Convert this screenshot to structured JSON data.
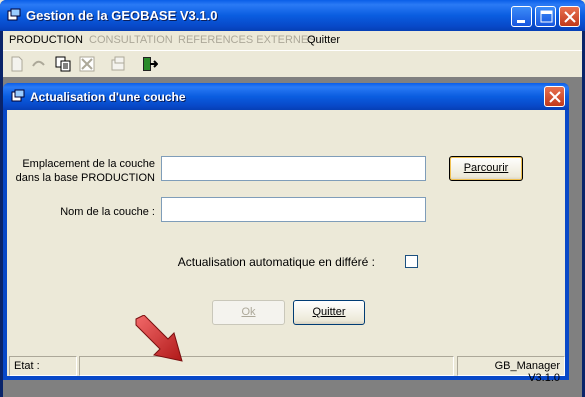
{
  "app": {
    "title": "Gestion de la GEOBASE V3.1.0"
  },
  "menu": {
    "items": [
      {
        "label": "PRODUCTION",
        "enabled": true
      },
      {
        "label": "CONSULTATION",
        "enabled": false
      },
      {
        "label": "REFERENCES EXTERNES",
        "enabled": false
      },
      {
        "label": "Quitter",
        "enabled": true
      }
    ]
  },
  "toolbar": {
    "icons": [
      "new-doc-icon",
      "refresh-icon",
      "copy-icon",
      "delete-icon",
      "properties-icon",
      "exit-icon"
    ]
  },
  "dialog": {
    "title": "Actualisation d'une couche",
    "location_label_line1": "Emplacement de la couche",
    "location_label_line2": "dans la base PRODUCTION",
    "location_value": "",
    "browse_button": "Parcourir",
    "layer_name_label": "Nom de la couche :",
    "layer_name_value": "",
    "auto_update_label": "Actualisation automatique en différé :",
    "auto_update_checked": false,
    "ok_button": "Ok",
    "quit_button": "Quitter",
    "status_label": "Etat :",
    "status_value": "",
    "version": "GB_Manager V3.1.0"
  },
  "colors": {
    "title_bar": "#0a5de0",
    "dialog_bg": "#ece9d8",
    "close_button": "#c1391b",
    "arrow": "#d42828"
  }
}
